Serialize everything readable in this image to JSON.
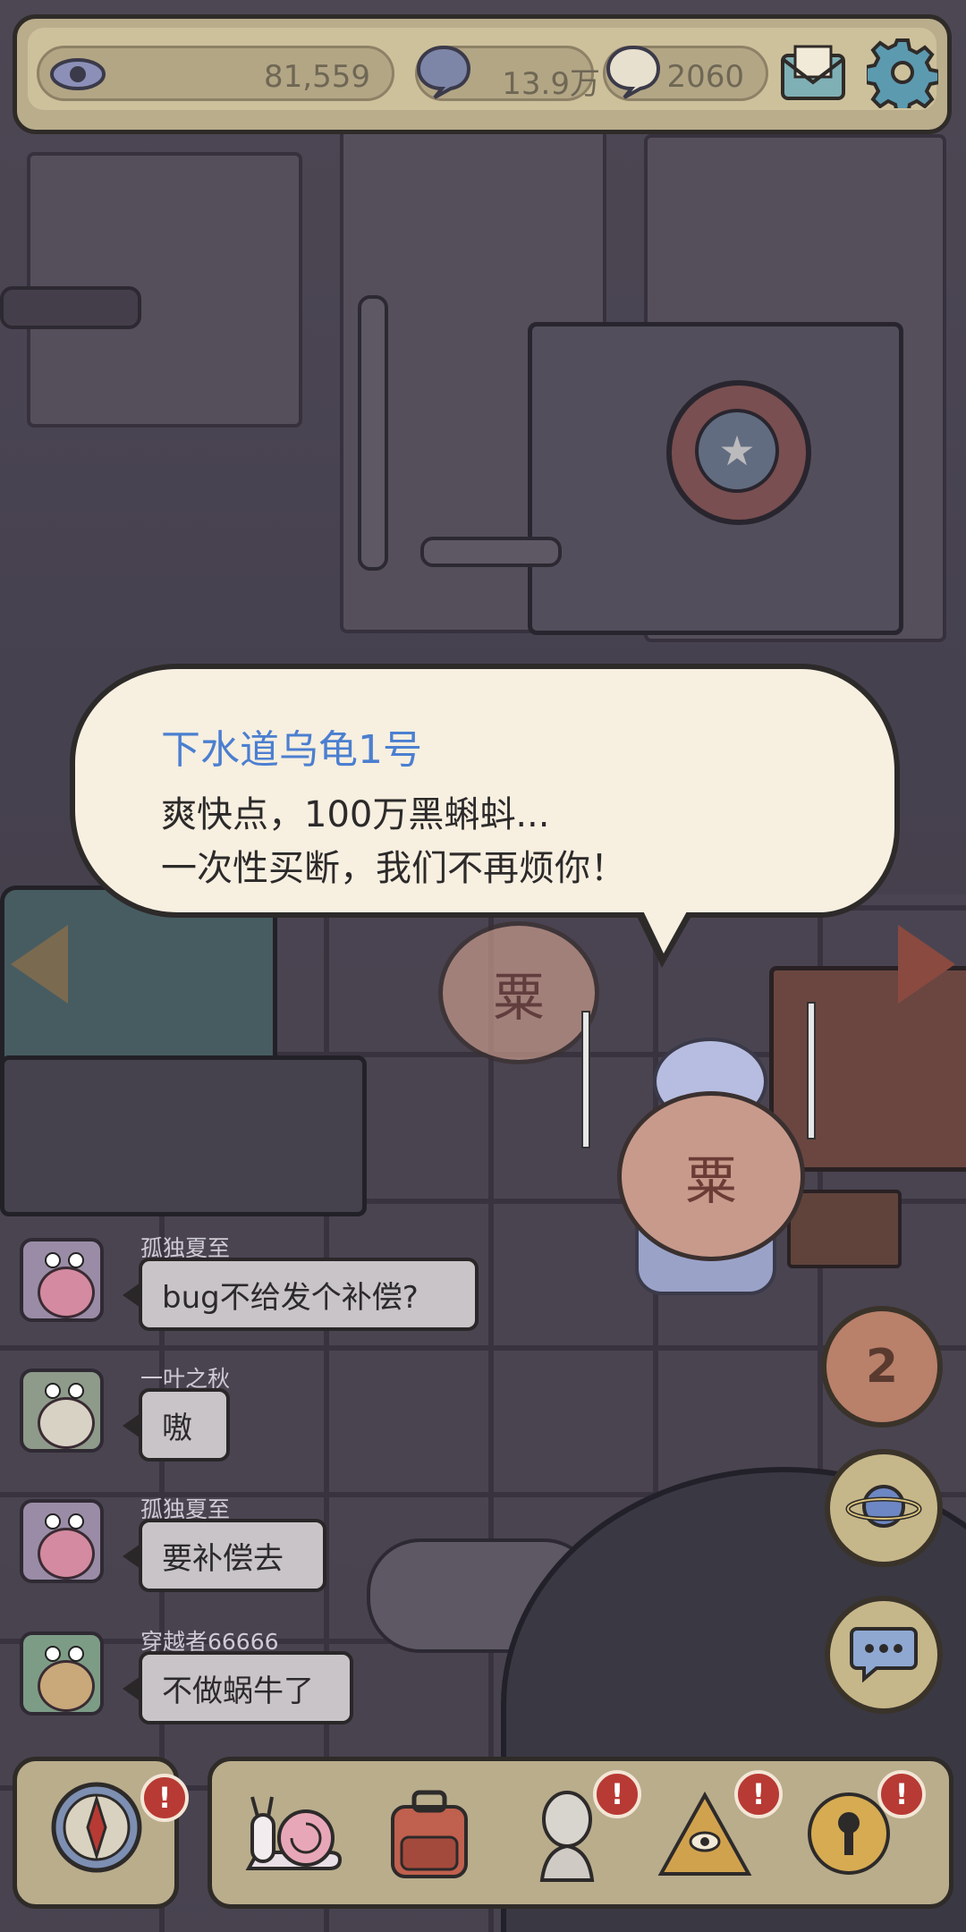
{
  "hud": {
    "views": "81,559",
    "comments": "13.9万",
    "messages": "2060",
    "icons": [
      "eye-icon",
      "comment-bubble-icon",
      "message-bubble-icon",
      "mail-icon",
      "gear-icon"
    ]
  },
  "dialog": {
    "speaker": "下水道乌龟1号",
    "line1": "爽快点，100万黑蝌蚪...",
    "line2": "一次性买断，我们不再烦你！"
  },
  "character": {
    "shell_char": "粟"
  },
  "chat": [
    {
      "name": "孤独夏至",
      "message": "bug不给发个补偿?"
    },
    {
      "name": "一叶之秋",
      "message": "嗷"
    },
    {
      "name": "孤独夏至",
      "message": "要补偿去"
    },
    {
      "name": "穿越者66666",
      "message": "不做蜗牛了"
    }
  ],
  "side_buttons": {
    "count_badge": "2",
    "icons": [
      "planet-icon",
      "chat-icon"
    ]
  },
  "bottom_bar": {
    "alert_mark": "!",
    "items": [
      "compass-icon",
      "snail-icon",
      "backpack-icon",
      "statue-icon",
      "pyramid-eye-icon",
      "key-icon"
    ]
  },
  "colors": {
    "hud_frame": "#b9ad8c",
    "speaker_name": "#4b7fd0",
    "alert_badge": "#b83a34",
    "bubble_bg": "#f7efe0"
  }
}
